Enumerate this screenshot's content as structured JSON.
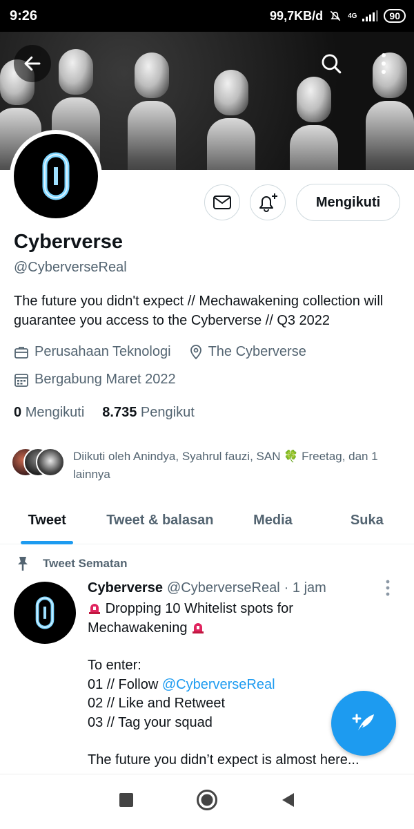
{
  "status_bar": {
    "time": "9:26",
    "net_speed": "99,7KB/d",
    "network": "4G",
    "battery": "90"
  },
  "header": {
    "back_icon": "arrow-left-icon",
    "search_icon": "search-icon",
    "more_icon": "more-vertical-icon"
  },
  "profile": {
    "name": "Cyberverse",
    "handle": "@CyberverseReal",
    "bio": "The future you didn't expect // Mechawakening collection will guarantee you access to the Cyberverse // Q3 2022",
    "category": "Perusahaan Teknologi",
    "location": "The Cyberverse",
    "joined": "Bergabung Maret 2022",
    "following_count": "0",
    "following_label": "Mengikuti",
    "followers_count": "8.735",
    "followers_label": "Pengikut",
    "followed_by": "Diikuti oleh Anindya, Syahrul fauzi, SAN 🍀 Freetag, dan 1 lainnya",
    "follow_button": "Mengikuti"
  },
  "tabs": [
    {
      "label": "Tweet",
      "active": true
    },
    {
      "label": "Tweet & balasan",
      "active": false
    },
    {
      "label": "Media",
      "active": false
    },
    {
      "label": "Suka",
      "active": false
    }
  ],
  "pinned_tweet": {
    "pinned_label": "Tweet Sematan",
    "author": "Cyberverse",
    "handle": "@CyberverseReal",
    "time": "· 1 jam",
    "line1": "Dropping 10 Whitelist spots for Mechawakening",
    "line2": "To enter:",
    "line3_prefix": "01 // Follow ",
    "line3_link": "@CyberverseReal",
    "line4": "02 // Like and Retweet",
    "line5": "03 // Tag your squad",
    "line6": "The future you didn’t expect is almost here..."
  },
  "colors": {
    "accent": "#1d9bf0",
    "text": "#0f1419",
    "secondary": "#536471"
  }
}
